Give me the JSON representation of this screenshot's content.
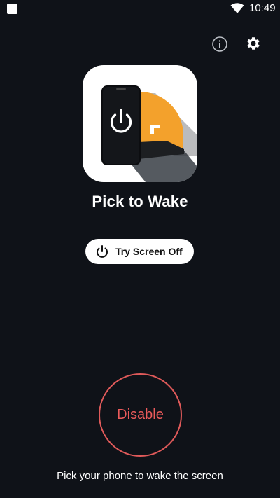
{
  "status_bar": {
    "time": "10:49",
    "icons": [
      "notification-icon",
      "wifi-icon"
    ]
  },
  "toolbar": {
    "info_icon": "info-icon",
    "settings_icon": "gear-icon"
  },
  "app": {
    "title": "Pick to Wake",
    "logo_icon": "phone-power-logo-icon"
  },
  "try_button": {
    "label": "Try Screen Off",
    "icon": "power-icon"
  },
  "disable_button": {
    "label": "Disable"
  },
  "footer": {
    "text": "Pick your phone to wake the screen"
  },
  "colors": {
    "background": "#0f1218",
    "accent_orange": "#f3a12c",
    "disable_red": "#e05a5a",
    "white": "#ffffff"
  }
}
